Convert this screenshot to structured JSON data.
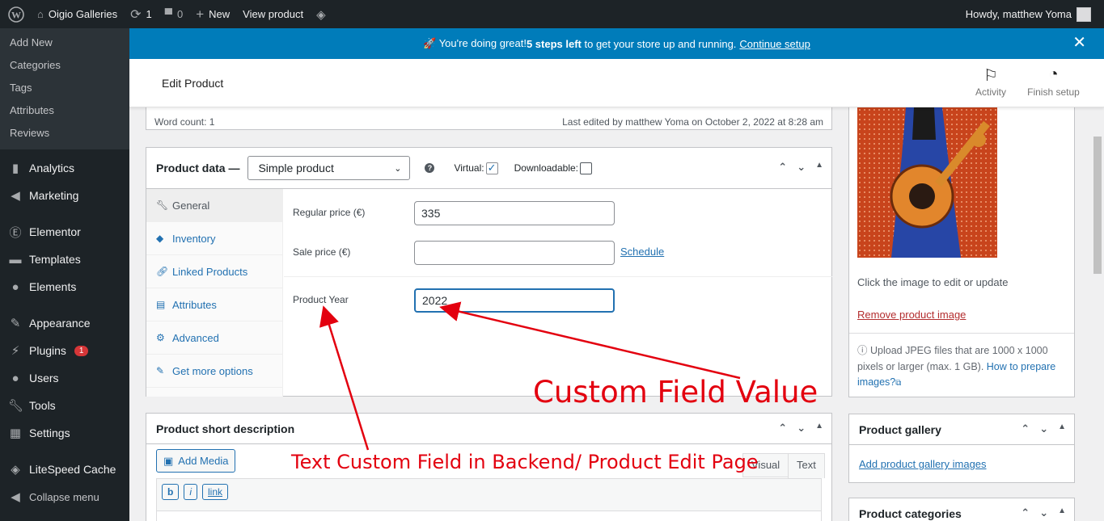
{
  "adminbar": {
    "site_name": "Oigio Galleries",
    "updates_count": "1",
    "comments_count": "0",
    "new_label": "New",
    "view_product": "View product",
    "howdy": "Howdy, matthew Yoma"
  },
  "sidebar": {
    "submenu": [
      "Add New",
      "Categories",
      "Tags",
      "Attributes",
      "Reviews"
    ],
    "menu": [
      {
        "label": "Analytics",
        "icon": "bar-chart-icon"
      },
      {
        "label": "Marketing",
        "icon": "megaphone-icon"
      },
      {
        "label": "Elementor",
        "icon": "elementor-icon"
      },
      {
        "label": "Templates",
        "icon": "folder-icon"
      },
      {
        "label": "Elements",
        "icon": "drop-icon"
      },
      {
        "label": "Appearance",
        "icon": "paintbrush-icon"
      },
      {
        "label": "Plugins",
        "icon": "plug-icon",
        "badge": "1"
      },
      {
        "label": "Users",
        "icon": "user-icon"
      },
      {
        "label": "Tools",
        "icon": "wrench-icon"
      },
      {
        "label": "Settings",
        "icon": "settings-icon"
      },
      {
        "label": "LiteSpeed Cache",
        "icon": "diamond-icon"
      },
      {
        "label": "Collapse menu",
        "icon": "collapse-icon"
      }
    ]
  },
  "notice": {
    "text_before": "🚀 You're doing great! ",
    "bold": "5 steps left",
    "text_after": " to get your store up and running.",
    "link": "Continue setup"
  },
  "header": {
    "title": "Edit Product",
    "activity": "Activity",
    "finish_setup": "Finish setup"
  },
  "editor_status": {
    "word_count": "Word count: 1",
    "last_edited": "Last edited by matthew Yoma on October 2, 2022 at 8:28 am"
  },
  "product_data": {
    "title": "Product data —",
    "type_selected": "Simple product",
    "virtual_label": "Virtual:",
    "virtual_checked": true,
    "downloadable_label": "Downloadable:",
    "downloadable_checked": false,
    "tabs": [
      {
        "label": "General",
        "icon": "wrench-icon"
      },
      {
        "label": "Inventory",
        "icon": "tag-icon"
      },
      {
        "label": "Linked Products",
        "icon": "link-icon"
      },
      {
        "label": "Attributes",
        "icon": "list-icon"
      },
      {
        "label": "Advanced",
        "icon": "gear-icon"
      },
      {
        "label": "Get more options",
        "icon": "plugin-icon"
      }
    ],
    "regular_price_label": "Regular price (€)",
    "regular_price_value": "335",
    "sale_price_label": "Sale price (€)",
    "sale_price_value": "",
    "schedule_link": "Schedule",
    "product_year_label": "Product Year",
    "product_year_value": "2022"
  },
  "short_description": {
    "title": "Product short description",
    "add_media": "Add Media",
    "visual_tab": "Visual",
    "text_tab": "Text",
    "quicktags": [
      "b",
      "i",
      "link"
    ]
  },
  "product_image": {
    "hint": "Click the image to edit or update",
    "remove": "Remove product image",
    "upload_info": "Upload JPEG files that are 1000 x 1000 pixels or larger (max. 1 GB).",
    "how_to": "How to prepare images?"
  },
  "gallery": {
    "title": "Product gallery",
    "add_link": "Add product gallery images"
  },
  "categories": {
    "title": "Product categories"
  },
  "annotations": {
    "custom_value": "Custom Field Value",
    "custom_field": "Text Custom Field in Backend/ Product Edit Page"
  },
  "colors": {
    "admin_dark": "#1d2327",
    "accent": "#2271b1",
    "notice_blue": "#007cba",
    "annotation_red": "#e3000f"
  }
}
